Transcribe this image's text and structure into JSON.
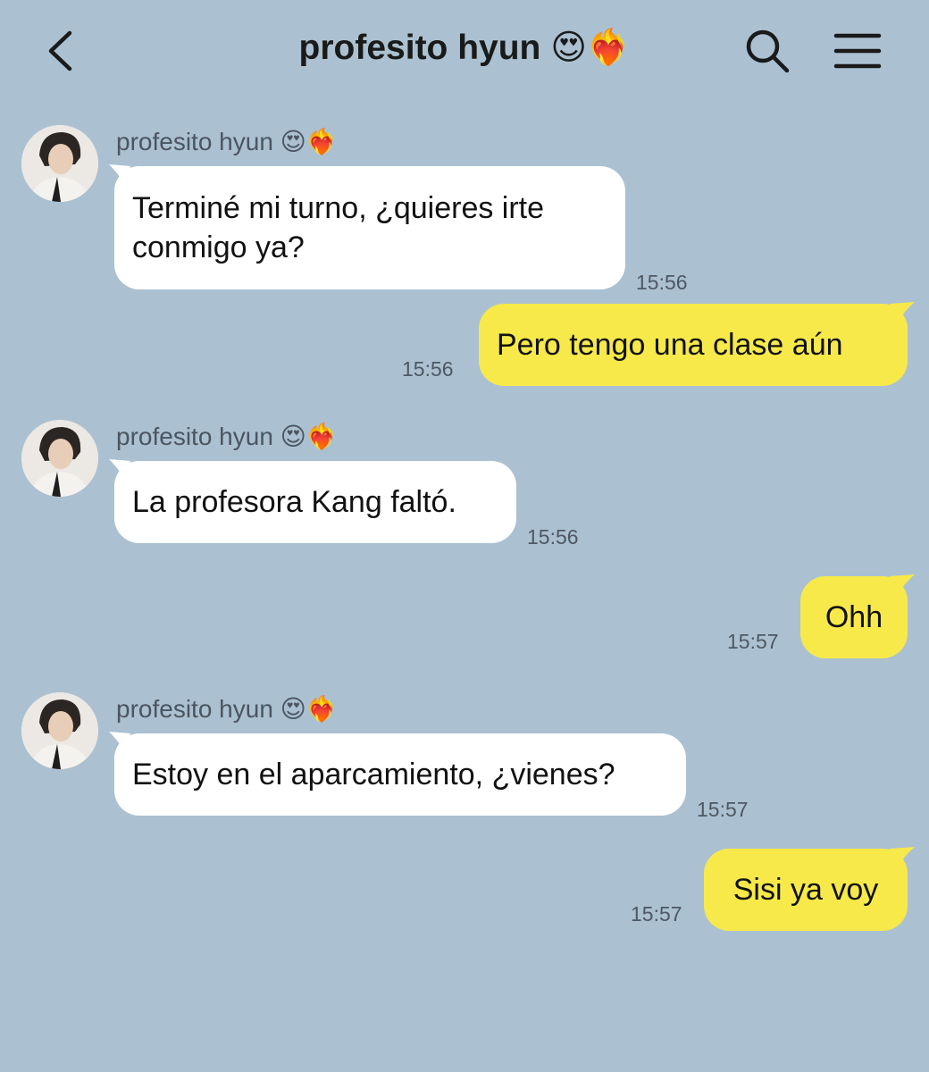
{
  "header": {
    "title": "profesito hyun",
    "title_emojis": "😍❤️‍🔥"
  },
  "contact": {
    "name": "profesito hyun",
    "name_emojis": "😍❤️‍🔥"
  },
  "messages": [
    {
      "from": "them",
      "text": "Terminé mi turno, ¿quieres irte conmigo ya?",
      "time": "15:56"
    },
    {
      "from": "me",
      "text": "Pero tengo una clase aún",
      "time": "15:56"
    },
    {
      "from": "them",
      "text": "La profesora Kang faltó.",
      "time": "15:56"
    },
    {
      "from": "me",
      "text": "Ohh",
      "time": "15:57"
    },
    {
      "from": "them",
      "text": "Estoy en el aparcamiento, ¿vienes?",
      "time": "15:57"
    },
    {
      "from": "me",
      "text": "Sisi ya voy",
      "time": "15:57"
    }
  ],
  "colors": {
    "background": "#abc1d1",
    "incoming_bubble": "#ffffff",
    "outgoing_bubble": "#f7e94a"
  },
  "icons": [
    "back-arrow-icon",
    "search-icon",
    "menu-icon"
  ]
}
